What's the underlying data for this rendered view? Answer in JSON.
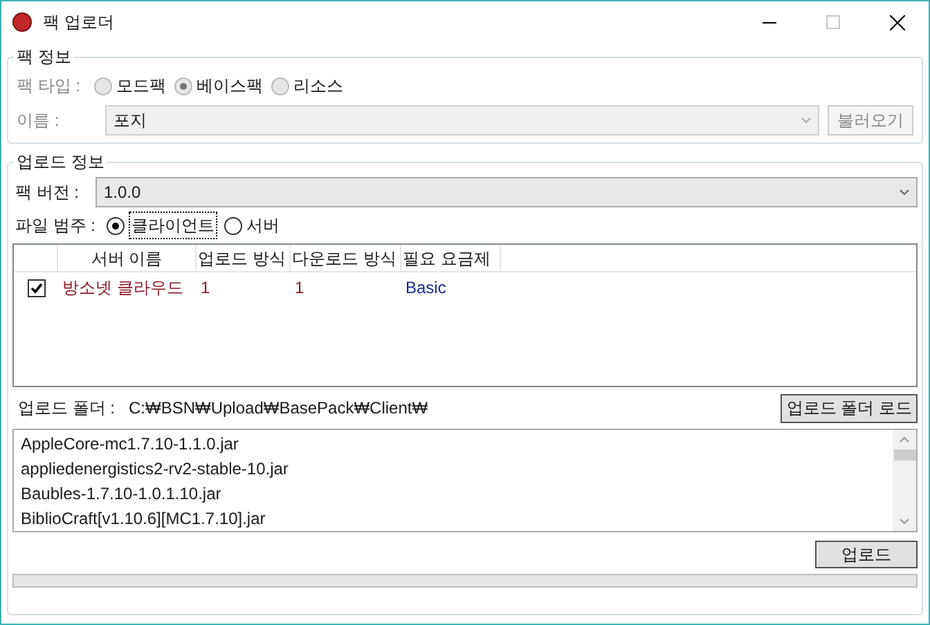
{
  "window": {
    "title": "팩 업로더"
  },
  "pack_info": {
    "title": "팩 정보",
    "disabled": true,
    "pack_type": {
      "label": "팩 타입 :",
      "options": [
        {
          "label": "모드팩",
          "selected": false
        },
        {
          "label": "베이스팩",
          "selected": true
        },
        {
          "label": "리소스",
          "selected": false
        }
      ]
    },
    "name": {
      "label": "이름 :",
      "value": "포지"
    },
    "load_button": "불러오기"
  },
  "upload_info": {
    "title": "업로드 정보",
    "version": {
      "label": "팩 버전 :",
      "value": "1.0.0"
    },
    "file_category": {
      "label": "파일 범주 :",
      "options": [
        {
          "label": "클라이언트",
          "selected": true
        },
        {
          "label": "서버",
          "selected": false
        }
      ]
    },
    "table": {
      "columns": [
        "서버 이름",
        "업로드 방식",
        "다운로드 방식",
        "필요 요금제"
      ],
      "rows": [
        {
          "checked": true,
          "cells": [
            "방소넷 클라우드",
            "1",
            "1",
            "Basic"
          ]
        }
      ]
    },
    "folder": {
      "label": "업로드 폴더 :",
      "path": "C:₩BSN₩Upload₩BasePack₩Client₩"
    },
    "load_folder_button": "업로드 폴더 로드",
    "files": [
      "AppleCore-mc1.7.10-1.1.0.jar",
      "appliedenergistics2-rv2-stable-10.jar",
      "Baubles-1.7.10-1.0.1.10.jar",
      "BiblioCraft[v1.10.6][MC1.7.10].jar"
    ],
    "upload_button": "업로드",
    "progress": {
      "level": 0
    }
  }
}
